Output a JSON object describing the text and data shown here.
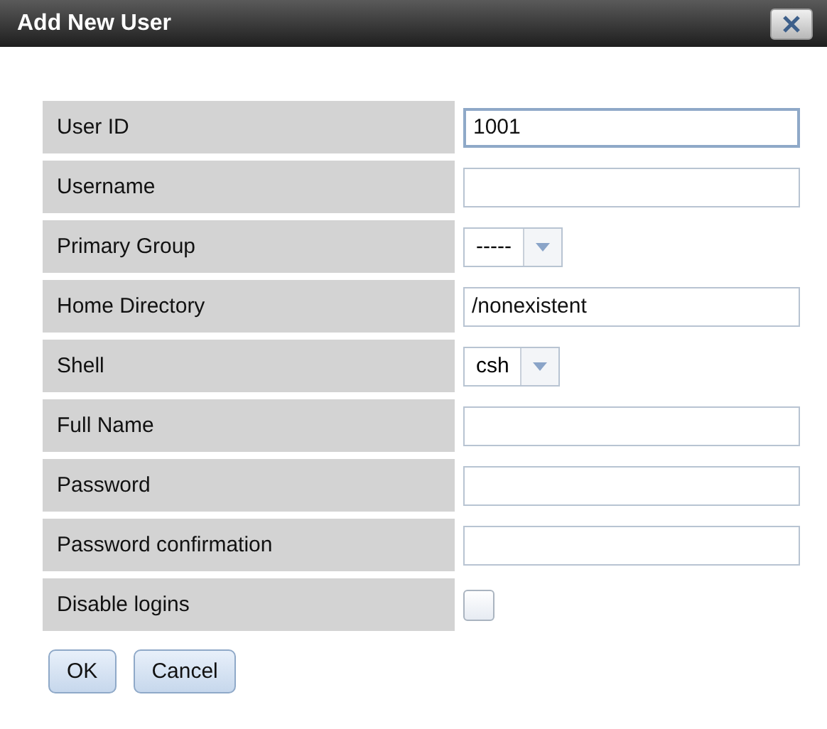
{
  "window": {
    "title": "Add New User"
  },
  "fields": [
    {
      "label": "User ID",
      "kind": "text",
      "value": "1001",
      "focused": true
    },
    {
      "label": "Username",
      "kind": "text",
      "focused": false
    },
    {
      "label": "Primary Group",
      "kind": "select",
      "value": "-----"
    },
    {
      "label": "Home Directory",
      "kind": "text",
      "value": "/nonexistent",
      "focused": false
    },
    {
      "label": "Shell",
      "kind": "select",
      "value": "csh"
    },
    {
      "label": "Full Name",
      "kind": "text",
      "focused": false
    },
    {
      "label": "Password",
      "kind": "text",
      "focused": false
    },
    {
      "label": "Password confirmation",
      "kind": "text",
      "focused": false
    },
    {
      "label": "Disable logins",
      "kind": "checkbox",
      "checked": false
    }
  ],
  "buttons": [
    "OK",
    "Cancel"
  ]
}
